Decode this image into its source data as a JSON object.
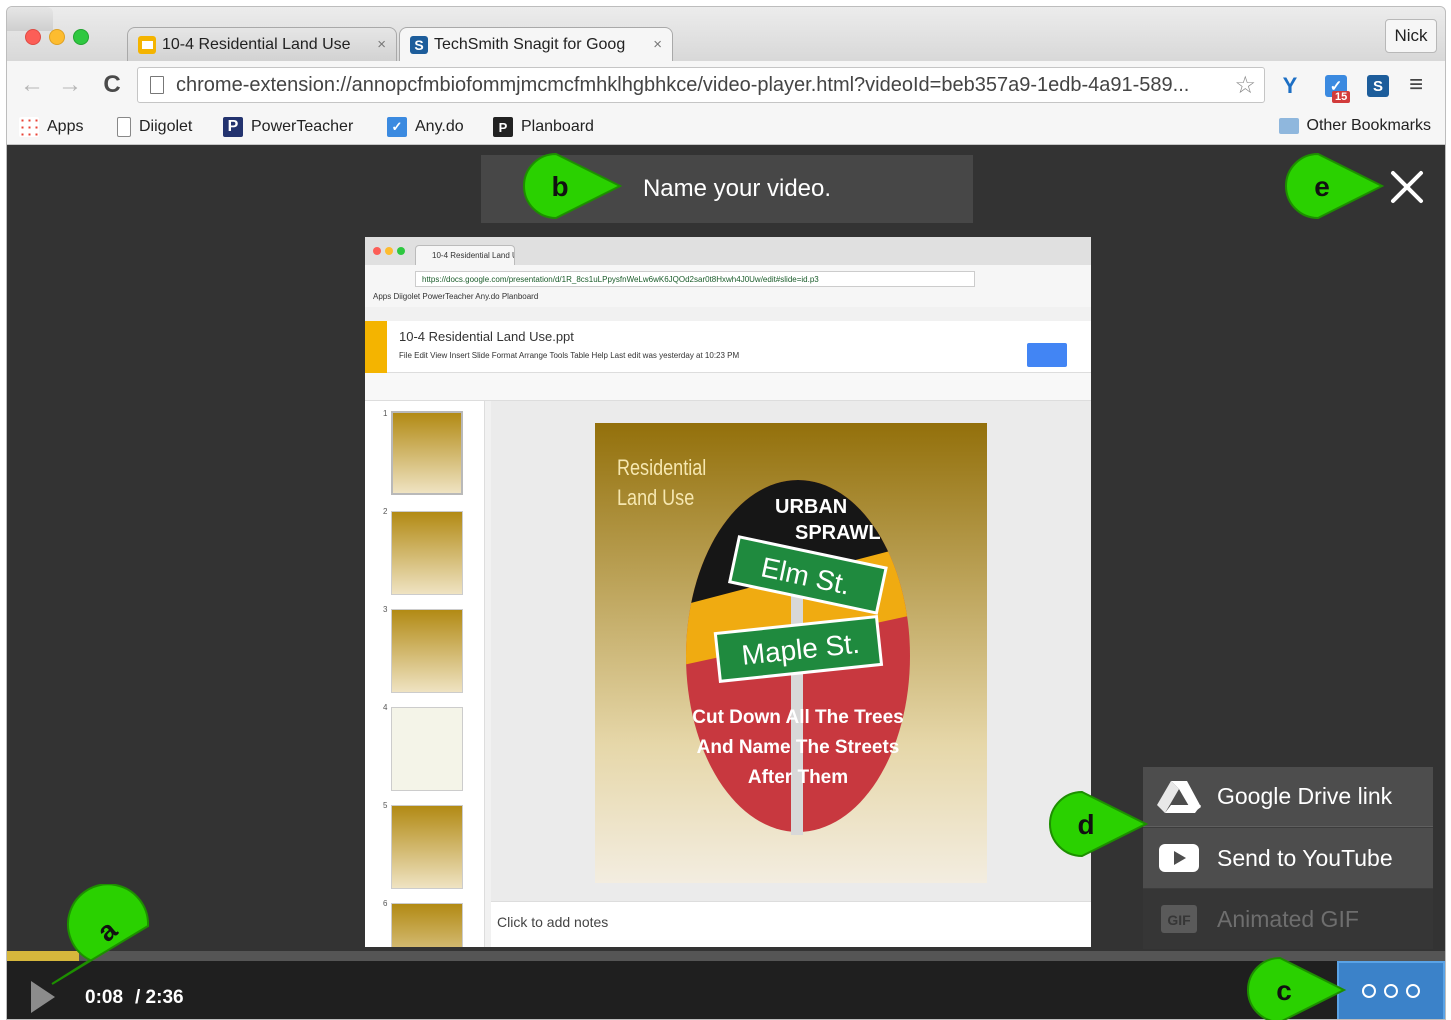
{
  "browser": {
    "tabs": [
      {
        "title": "10-4 Residential Land Use",
        "close": "×"
      },
      {
        "title": "TechSmith Snagit for Goog",
        "close": "×"
      }
    ],
    "profile": "Nick",
    "url": "chrome-extension://annopcfmbiofommjmcmcfmhklhgbhkce/video-player.html?videoId=beb357a9-1edb-4a91-589...",
    "extensions": {
      "anydo_badge": "15"
    },
    "bookmarks": [
      "Apps",
      "Diigolet",
      "PowerTeacher",
      "Any.do",
      "Planboard"
    ],
    "other_bookmarks": "Other Bookmarks"
  },
  "player": {
    "title_placeholder": "Name your video.",
    "time_current": "0:08",
    "time_total": "/ 2:36",
    "progress": 0.05,
    "share_menu": [
      {
        "label": "Google Drive link",
        "icon": "google-drive-icon",
        "enabled": true
      },
      {
        "label": "Send to YouTube",
        "icon": "youtube-icon",
        "enabled": true
      },
      {
        "label": "Animated GIF",
        "icon": "gif-icon",
        "enabled": false
      }
    ]
  },
  "video_content": {
    "tab_title": "10-4 Residential Land Us",
    "url": "https://docs.google.com/presentation/d/1R_8cs1uLPpysfnWeLw6wK6JQOd2sar0t8Hxwh4J0Uw/edit#slide=id.p3",
    "bookmarks": "Apps  Diigolet  PowerTeacher  Any.do  Planboard",
    "doc_title": "10-4 Residential Land Use.ppt",
    "doc_menu": "File  Edit  View  Insert  Slide  Format  Arrange  Tools  Table  Help    Last edit was yesterday at 10:23 PM",
    "slide_title": "Residential\nLand Use",
    "graphic_text": {
      "top1": "URBAN",
      "top2": "SPRAWL",
      "sign1": "Elm St.",
      "sign2": "Maple St.",
      "bottom1": "Cut Down All The Trees",
      "bottom2": "And Name The Streets",
      "bottom3": "After Them"
    },
    "thumb_numbers": [
      "1",
      "2",
      "3",
      "4",
      "5",
      "6"
    ],
    "notes_placeholder": "Click to add notes"
  },
  "callouts": {
    "a": "a",
    "b": "b",
    "c": "c",
    "d": "d",
    "e": "e"
  },
  "colors": {
    "callout_green": "#2ad100",
    "accent_blue": "#3b82c9",
    "progress_yellow": "#d6b73c"
  }
}
